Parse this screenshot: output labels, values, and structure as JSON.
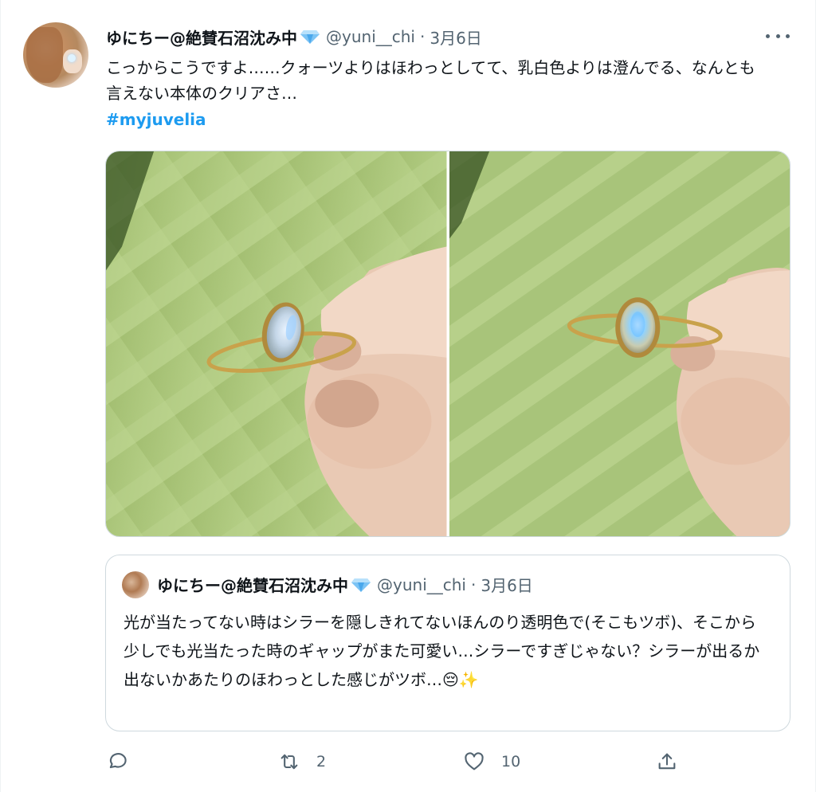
{
  "tweet": {
    "author_name": "ゆにちー@絶賛石沼沈み中",
    "handle": "@yuni__chi",
    "separator": "·",
    "date": "3月6日",
    "text": "こっからこうですよ……クォーツよりはほわっとしてて、乳白色よりは澄んでる、なんとも言えない本体のクリアさ…",
    "hashtag": "#myjuvelia",
    "more_icon": "more-horizontal-icon"
  },
  "quote": {
    "author_name": "ゆにちー@絶賛石沼沈み中",
    "handle": "@yuni__chi",
    "separator": "·",
    "date": "3月6日",
    "text": "光が当たってない時はシラーを隠しきれてないほんのり透明色で(そこもツボ)、そこから少しでも光当たった時のギャップがまた可愛い…シラーですぎじゃない？シラーが出るか出ないかあたりのほわっとした感じがツボ…😔✨"
  },
  "actions": {
    "reply_icon": "reply-icon",
    "retweet_icon": "retweet-icon",
    "retweet_count": "2",
    "like_icon": "heart-icon",
    "like_count": "10",
    "share_icon": "share-icon"
  },
  "colors": {
    "link": "#1d9bf0",
    "secondary_text": "#536471",
    "border": "#cfd9de",
    "photo_background": "#a8c47a"
  }
}
